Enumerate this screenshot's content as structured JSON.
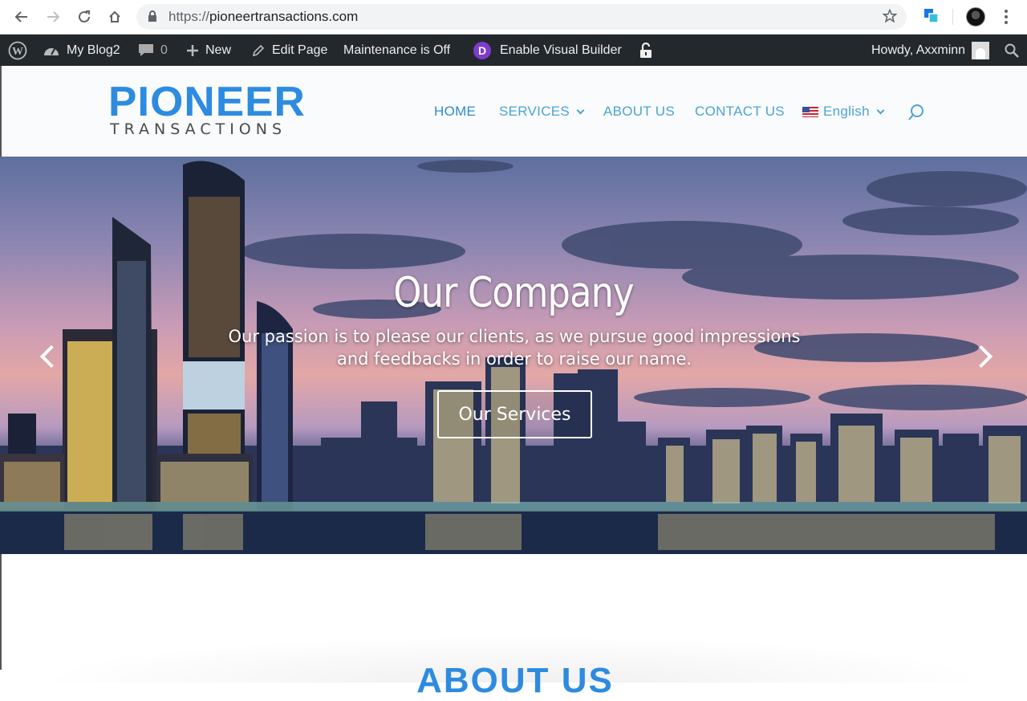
{
  "browser": {
    "url_protocol": "https://",
    "url_host": "pioneertransactions.com"
  },
  "admin_bar": {
    "site_name": "My Blog2",
    "comments_count": "0",
    "new_label": "New",
    "edit_page_label": "Edit Page",
    "maintenance_label": "Maintenance is Off",
    "divi_letter": "D",
    "visual_builder_label": "Enable Visual Builder",
    "howdy_label": "Howdy, Axxminn"
  },
  "header": {
    "logo_line1": "PIONEER",
    "logo_line2": "TRANSACTIONS",
    "menu": {
      "home": "HOME",
      "services": "SERVICES",
      "about": "ABOUT US",
      "contact": "CONTACT US",
      "language": "English"
    }
  },
  "hero": {
    "title": "Our Company",
    "subtitle": "Our passion is to please our clients, as we pursue good impressions and feedbacks in order to raise our name.",
    "button_label": "Our Services"
  },
  "below": {
    "heading": "ABOUT US"
  },
  "colors": {
    "brand_blue": "#2d8be0",
    "menu_blue": "#4ba3d9",
    "admin_bar_bg": "#23282d",
    "divi_purple": "#7e3bd0"
  }
}
